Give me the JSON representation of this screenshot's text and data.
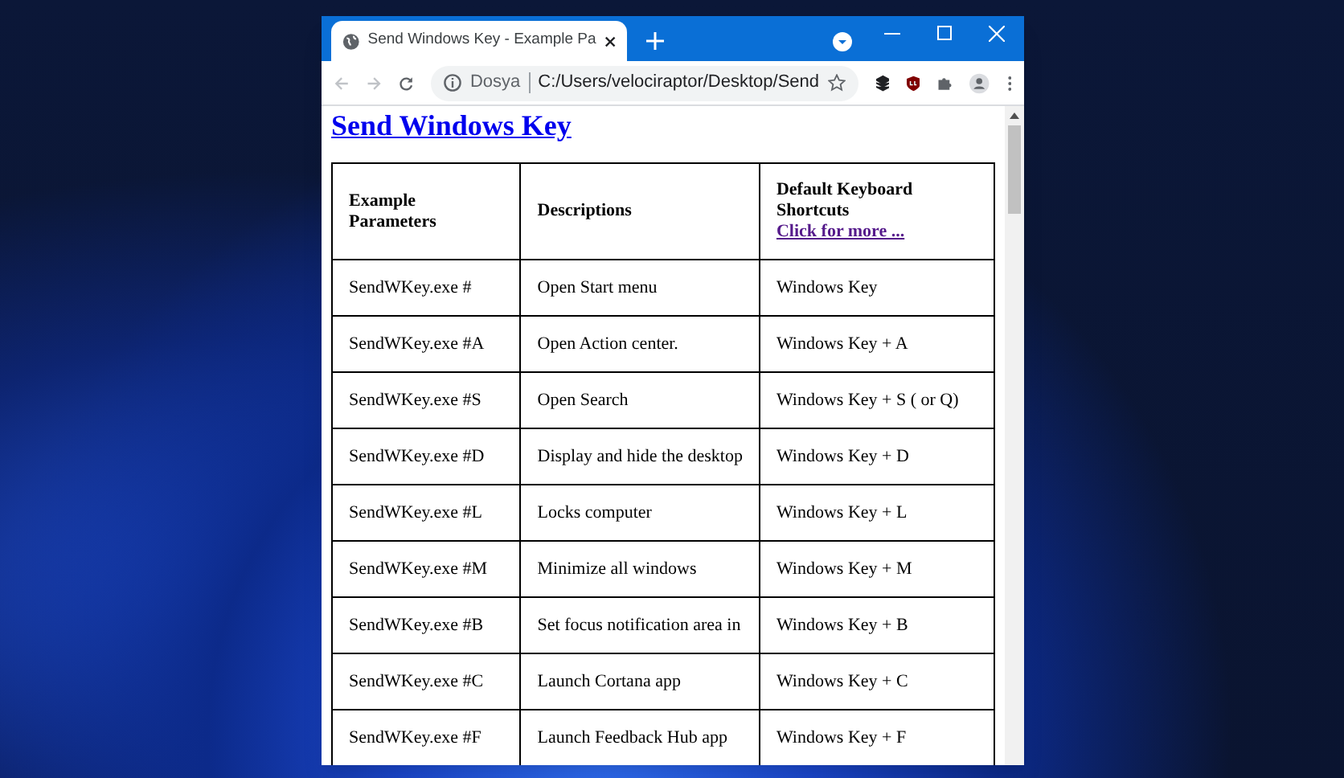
{
  "browser": {
    "tab": {
      "title": "Send Windows Key - Example Pa",
      "selected": true
    },
    "address": {
      "label": "Dosya",
      "url": "C:/Users/velociraptor/Desktop/Send"
    }
  },
  "page": {
    "heading": "Send Windows Key",
    "table": {
      "columns": [
        "Example Parameters",
        "Descriptions",
        "Default Keyboard Shortcuts"
      ],
      "header_link": "Click for more ...",
      "rows": [
        [
          "SendWKey.exe #",
          "Open Start menu",
          "Windows Key"
        ],
        [
          "SendWKey.exe #A",
          "Open Action center.",
          "Windows Key + A"
        ],
        [
          "SendWKey.exe #S",
          "Open Search",
          "Windows Key + S ( or Q)"
        ],
        [
          "SendWKey.exe #D",
          "Display and hide the desktop",
          "Windows Key + D"
        ],
        [
          "SendWKey.exe #L",
          "Locks computer",
          "Windows Key + L"
        ],
        [
          "SendWKey.exe #M",
          "Minimize all windows",
          "Windows Key + M"
        ],
        [
          "SendWKey.exe #B",
          "Set focus notification area in",
          "Windows Key + B"
        ],
        [
          "SendWKey.exe #C",
          "Launch Cortana app",
          "Windows Key + C"
        ],
        [
          "SendWKey.exe #F",
          "Launch Feedback Hub app",
          "Windows Key + F"
        ]
      ]
    }
  }
}
